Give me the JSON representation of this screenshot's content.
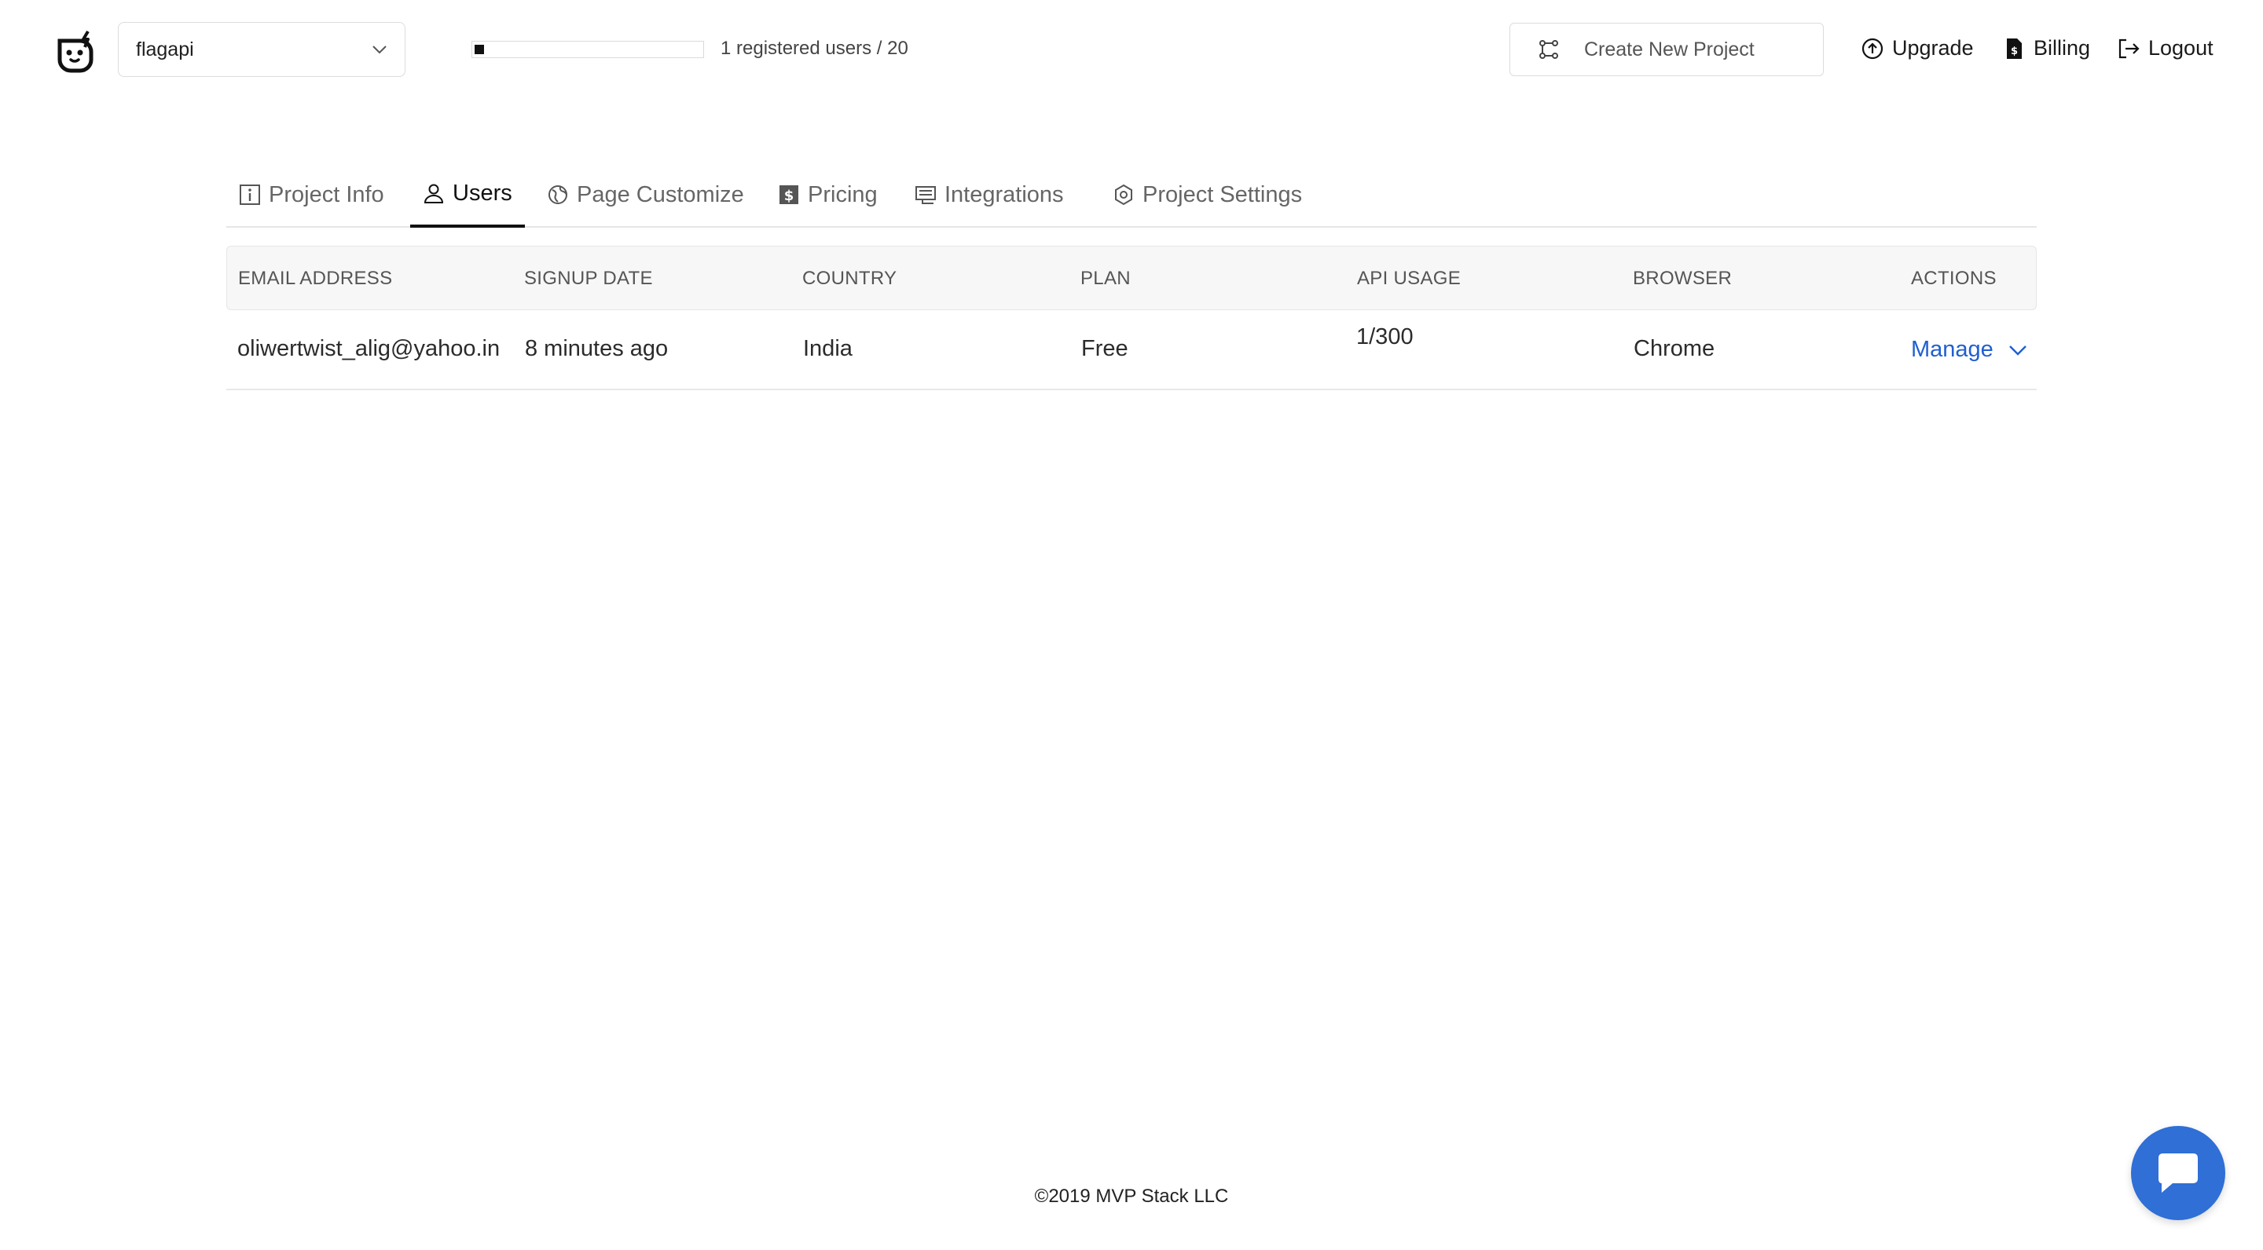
{
  "header": {
    "project_selected": "flagapi",
    "usage": {
      "text": "1 registered users / 20",
      "registered": 1,
      "limit": 20
    },
    "create_button_label": "Create New Project",
    "links": {
      "upgrade": "Upgrade",
      "billing": "Billing",
      "logout": "Logout"
    }
  },
  "tabs": [
    {
      "label": "Project Info",
      "icon": "info-icon",
      "active": false
    },
    {
      "label": "Users",
      "icon": "users-icon",
      "active": true
    },
    {
      "label": "Page Customize",
      "icon": "globe-icon",
      "active": false
    },
    {
      "label": "Pricing",
      "icon": "dollar-icon",
      "active": false
    },
    {
      "label": "Integrations",
      "icon": "integrations-icon",
      "active": false
    },
    {
      "label": "Project Settings",
      "icon": "settings-icon",
      "active": false
    }
  ],
  "table": {
    "columns": [
      "EMAIL ADDRESS",
      "SIGNUP DATE",
      "COUNTRY",
      "PLAN",
      "API USAGE",
      "BROWSER",
      "ACTIONS"
    ],
    "rows": [
      {
        "email": "oliwertwist_alig@yahoo.in",
        "signup": "8 minutes ago",
        "country": "India",
        "plan": "Free",
        "api_usage": "1/300",
        "browser": "Chrome",
        "action": "Manage"
      }
    ]
  },
  "footer": {
    "text": "©2019 MVP Stack LLC"
  },
  "colors": {
    "link": "#1f5fd1",
    "chat_bubble": "#2f6fd6"
  }
}
